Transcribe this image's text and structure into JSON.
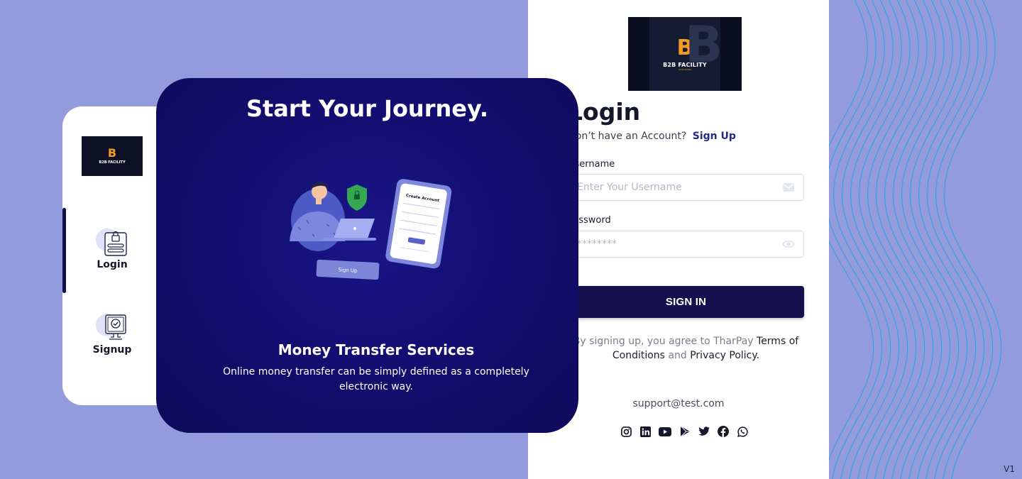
{
  "brand": {
    "logo_glyph": "B",
    "logo_name": "B2B FACILITY",
    "logo_tagline": "SOLUTIONS"
  },
  "hero": {
    "title": "Start Your Journey.",
    "illustration": {
      "card_title": "Create Account",
      "button_label": "Sign Up"
    },
    "subtitle": "Money Transfer Services",
    "description": "Online money transfer can be simply defined as a completely electronic way."
  },
  "sidebar": {
    "items": [
      {
        "label": "Login",
        "icon": "login-lock-icon",
        "active": true
      },
      {
        "label": "Signup",
        "icon": "signup-check-icon",
        "active": false
      }
    ]
  },
  "login": {
    "title": "Login",
    "no_account_text": "Don’t have an Account?",
    "signup_link": "Sign Up",
    "username_label": "Username",
    "username_placeholder": "Enter Your Username",
    "password_label": "Password",
    "password_placeholder": "********",
    "signin_button": "SIGN IN",
    "terms_prefix": "By signing up, you agree to TharPay",
    "terms_link": "Terms of Conditions",
    "terms_and": "and",
    "privacy_link": "Privacy Policy.",
    "support_email": "support@test.com",
    "social_icons": [
      "instagram-icon",
      "linkedin-icon",
      "youtube-icon",
      "google-play-icon",
      "twitter-icon",
      "facebook-icon",
      "whatsapp-icon"
    ]
  },
  "version": "V1",
  "colors": {
    "background": "#939bdc",
    "primary_dark": "#15104d",
    "hero_bg": "#120c6a",
    "link": "#1d2a8a",
    "wave_line": "#2f9fe8"
  }
}
